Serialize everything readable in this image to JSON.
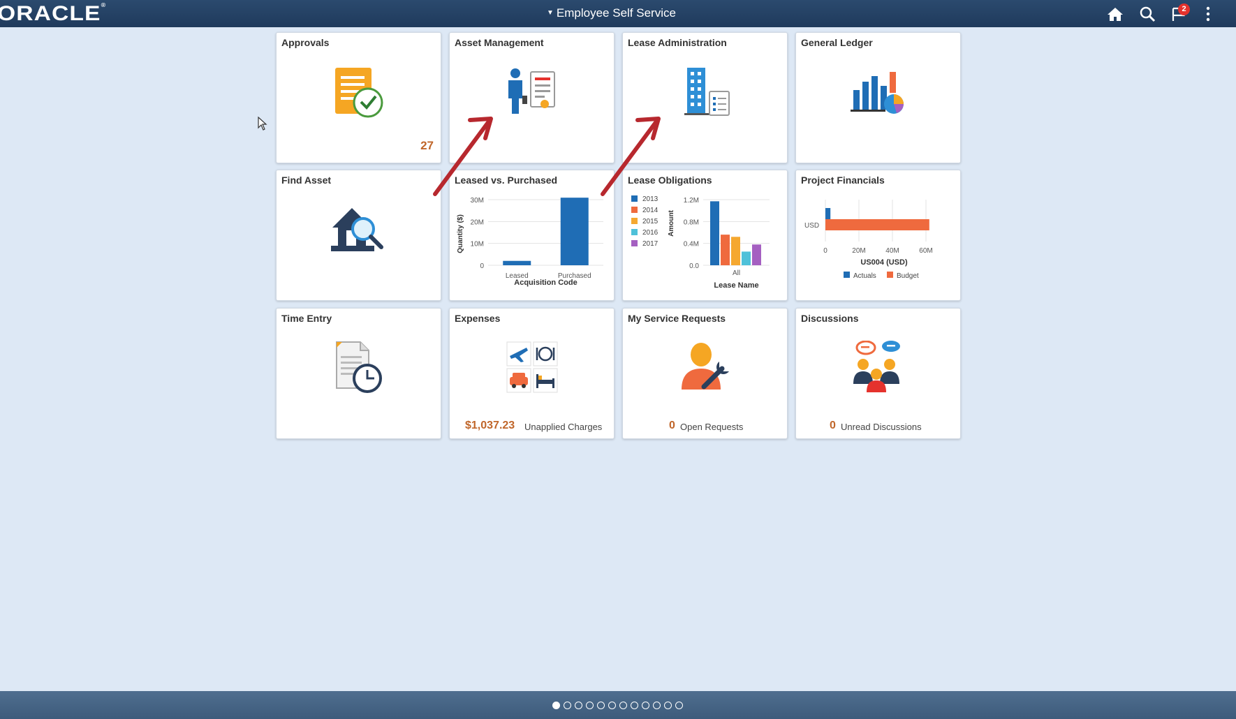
{
  "header": {
    "logo": "ORACLE",
    "title": "Employee Self Service",
    "notification_count": "2",
    "icons": [
      "home-icon",
      "search-icon",
      "notifications-icon",
      "actions-menu-icon"
    ]
  },
  "tiles": {
    "approvals": {
      "title": "Approvals",
      "count": "27",
      "icon": "document-check-icon"
    },
    "asset_management": {
      "title": "Asset Management",
      "icon": "person-document-icon"
    },
    "lease_administration": {
      "title": "Lease Administration",
      "icon": "building-list-icon"
    },
    "general_ledger": {
      "title": "General Ledger",
      "icon": "bar-pie-chart-icon"
    },
    "find_asset": {
      "title": "Find Asset",
      "icon": "house-magnifier-icon"
    },
    "leased_vs_purchased": {
      "title": "Leased vs. Purchased"
    },
    "lease_obligations": {
      "title": "Lease Obligations"
    },
    "project_financials": {
      "title": "Project Financials"
    },
    "time_entry": {
      "title": "Time Entry",
      "icon": "document-clock-icon"
    },
    "expenses": {
      "title": "Expenses",
      "amount": "$1,037.23",
      "label": "Unapplied Charges",
      "icon": "travel-expense-icon"
    },
    "service_requests": {
      "title": "My Service Requests",
      "count": "0",
      "label": "Open Requests",
      "icon": "person-wrench-icon"
    },
    "discussions": {
      "title": "Discussions",
      "count": "0",
      "label": "Unread Discussions",
      "icon": "people-chat-icon"
    }
  },
  "chart_data": [
    {
      "type": "bar",
      "categories": [
        "Leased",
        "Purchased"
      ],
      "values": [
        2000000,
        31000000
      ],
      "xlabel": "Acquisition Code",
      "ylabel": "Quantity ($)",
      "ylim": [
        0,
        30000000
      ],
      "yticks": [
        "0",
        "10M",
        "20M",
        "30M"
      ],
      "color": "#1f6db5"
    },
    {
      "type": "bar",
      "categories": [
        "All"
      ],
      "series": [
        {
          "name": "2013",
          "values": [
            1170000
          ],
          "color": "#1f6db5"
        },
        {
          "name": "2014",
          "values": [
            560000
          ],
          "color": "#ef6a3e"
        },
        {
          "name": "2015",
          "values": [
            520000
          ],
          "color": "#f5a830"
        },
        {
          "name": "2016",
          "values": [
            250000
          ],
          "color": "#4fc1d9"
        },
        {
          "name": "2017",
          "values": [
            380000
          ],
          "color": "#a560c1"
        }
      ],
      "xlabel": "Lease Name",
      "ylabel": "Amount",
      "ylim": [
        0,
        1200000
      ],
      "yticks": [
        "0.0",
        "0.4M",
        "0.8M",
        "1.2M"
      ],
      "legend": "left"
    },
    {
      "type": "bar",
      "orientation": "horizontal",
      "categories": [
        "USD"
      ],
      "series": [
        {
          "name": "Actuals",
          "values": [
            3000000
          ],
          "color": "#1f6db5"
        },
        {
          "name": "Budget",
          "values": [
            62000000
          ],
          "color": "#ef6a3e"
        }
      ],
      "xlabel": "US004 (USD)",
      "xlim": [
        0,
        70000000
      ],
      "xticks": [
        "0",
        "20M",
        "40M",
        "60M"
      ],
      "legend": "bottom"
    }
  ],
  "pager": {
    "pages": 12,
    "active": 0
  }
}
